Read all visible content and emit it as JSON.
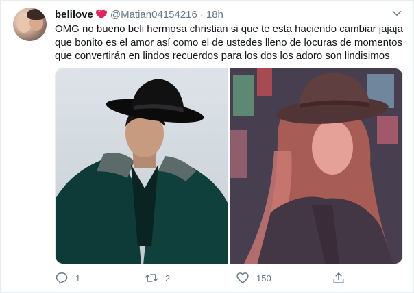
{
  "tweet": {
    "user": {
      "name": "belilove",
      "handle": "@Matian04154216",
      "separator": "·",
      "time": "18h",
      "avatar_icon": "profile-photo",
      "badge_icon": "sparkling-heart-emoji"
    },
    "text_lines": [
      "OMG no bueno beli hermosa christian si que te esta haciendo cambiar jajaja",
      "que bonito es el amor así como el de ustedes lleno de locuras de momentos",
      "que convertirán en lindos recuerdos para los dos los adoro son lindisimos"
    ],
    "media": {
      "photos": [
        {
          "description_icon": "man-in-black-cowboy-hat-velvet-jacket"
        },
        {
          "description_icon": "woman-in-brown-hat-city-lights"
        }
      ]
    },
    "actions": {
      "reply": {
        "count": "1",
        "icon": "reply-icon"
      },
      "retweet": {
        "count": "2",
        "icon": "retweet-icon"
      },
      "like": {
        "count": "150",
        "icon": "heart-icon"
      },
      "share": {
        "icon": "share-icon"
      }
    },
    "colors": {
      "text": "#14171a",
      "muted": "#657786",
      "border": "#e6ecf0",
      "heart_badge": "#e0245e"
    }
  }
}
